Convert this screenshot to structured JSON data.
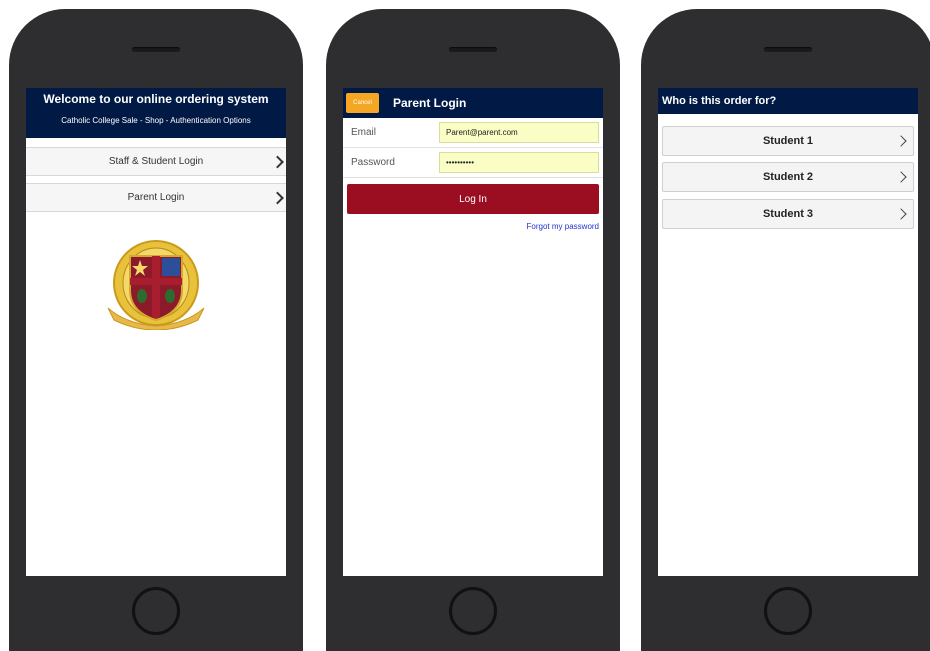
{
  "screens": {
    "welcome": {
      "title": "Welcome to our online ordering system",
      "subtitle": "Catholic College Sale - Shop - Authentication Options",
      "items": [
        {
          "label": "Staff & Student Login"
        },
        {
          "label": "Parent Login"
        }
      ],
      "crest_icon": "school-crest-icon"
    },
    "parent_login": {
      "cancel_label": "Cancel",
      "title": "Parent Login",
      "email_label": "Email",
      "email_value": "Parent@parent.com",
      "password_label": "Password",
      "password_value": "••••••••••",
      "login_label": "Log In",
      "forgot_label": "Forgot my password"
    },
    "student_select": {
      "title": "Who is this order for?",
      "students": [
        {
          "label": "Student 1"
        },
        {
          "label": "Student 2"
        },
        {
          "label": "Student 3"
        }
      ]
    }
  },
  "colors": {
    "header_navy": "#011a45",
    "cancel_orange": "#f5a623",
    "login_red": "#9b0d20",
    "input_yellow": "#fafec4",
    "link_blue": "#2233cc",
    "phone_body": "#2e2e30"
  }
}
